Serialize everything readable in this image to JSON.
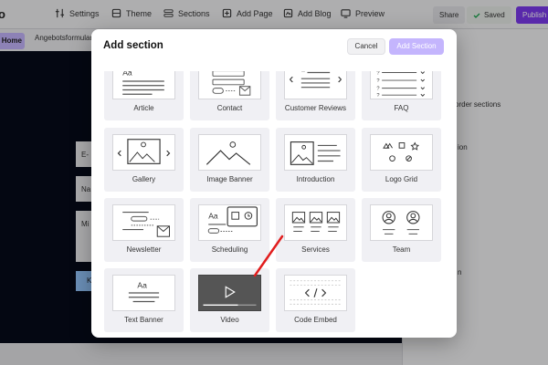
{
  "topbar": {
    "logo": "o",
    "nav": [
      "Settings",
      "Theme",
      "Sections",
      "Add Page",
      "Add Blog",
      "Preview"
    ],
    "share": "Share",
    "saved": "Saved",
    "publish": "Publish"
  },
  "tabs": {
    "home": "Home",
    "other": "Angebotsformular"
  },
  "canvas": {
    "fields": [
      "E-",
      "Na",
      "Mi"
    ],
    "button": "K"
  },
  "right_panel": {
    "line1": "order sections",
    "line2": "ion",
    "line3": "n"
  },
  "modal": {
    "title": "Add section",
    "cancel": "Cancel",
    "add": "Add Section",
    "sections": [
      {
        "label": "Article",
        "icon": "article-icon"
      },
      {
        "label": "Contact",
        "icon": "contact-icon"
      },
      {
        "label": "Customer Reviews",
        "icon": "reviews-icon"
      },
      {
        "label": "FAQ",
        "icon": "faq-icon"
      },
      {
        "label": "Gallery",
        "icon": "gallery-icon"
      },
      {
        "label": "Image Banner",
        "icon": "image-banner-icon"
      },
      {
        "label": "Introduction",
        "icon": "introduction-icon"
      },
      {
        "label": "Logo Grid",
        "icon": "logo-grid-icon"
      },
      {
        "label": "Newsletter",
        "icon": "newsletter-icon"
      },
      {
        "label": "Scheduling",
        "icon": "scheduling-icon"
      },
      {
        "label": "Services",
        "icon": "services-icon"
      },
      {
        "label": "Team",
        "icon": "team-icon"
      },
      {
        "label": "Text Banner",
        "icon": "text-banner-icon"
      },
      {
        "label": "Video",
        "icon": "video-icon"
      },
      {
        "label": "Code Embed",
        "icon": "code-embed-icon"
      }
    ]
  },
  "colors": {
    "accent": "#7c3aed",
    "accent_light": "#c4b5fd",
    "annotation": "#e11d1d"
  }
}
